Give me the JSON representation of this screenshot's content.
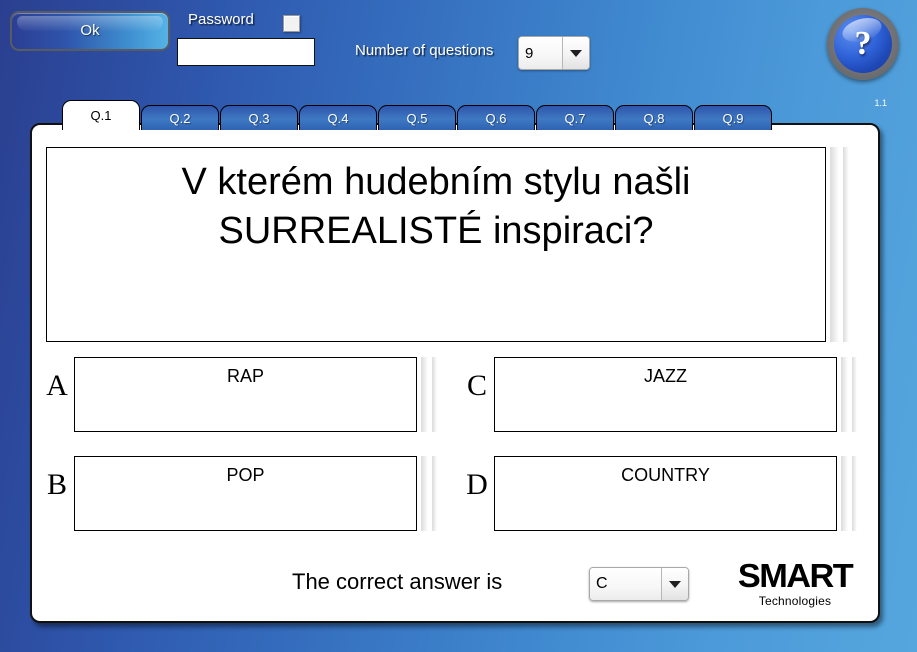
{
  "toolbar": {
    "ok_label": "Ok",
    "password_label": "Password",
    "password_value": "",
    "password_placeholder": "",
    "password_checked": false,
    "number_of_questions_label": "Number of questions",
    "number_of_questions_value": "9",
    "help_glyph": "?",
    "version": "1.1"
  },
  "tabs": [
    {
      "label": "Q.1",
      "active": true
    },
    {
      "label": "Q.2",
      "active": false
    },
    {
      "label": "Q.3",
      "active": false
    },
    {
      "label": "Q.4",
      "active": false
    },
    {
      "label": "Q.5",
      "active": false
    },
    {
      "label": "Q.6",
      "active": false
    },
    {
      "label": "Q.7",
      "active": false
    },
    {
      "label": "Q.8",
      "active": false
    },
    {
      "label": "Q.9",
      "active": false
    }
  ],
  "question": {
    "text": "V kterém hudebním stylu našli SURREALISTÉ inspiraci?"
  },
  "answers": [
    {
      "letter": "A",
      "text": "RAP"
    },
    {
      "letter": "B",
      "text": "POP"
    },
    {
      "letter": "C",
      "text": "JAZZ"
    },
    {
      "letter": "D",
      "text": "COUNTRY"
    }
  ],
  "footer": {
    "correct_answer_label": "The correct answer is",
    "correct_answer_value": "C",
    "brand_word": "SMART",
    "brand_sub": "Technologies"
  },
  "colors": {
    "bg_left": "#2b3f8f",
    "bg_right": "#55a6de",
    "tab_active_bg": "#ffffff",
    "tab_bg": "#3e79c3",
    "panel_bg": "#ffffff",
    "border": "#000000"
  }
}
